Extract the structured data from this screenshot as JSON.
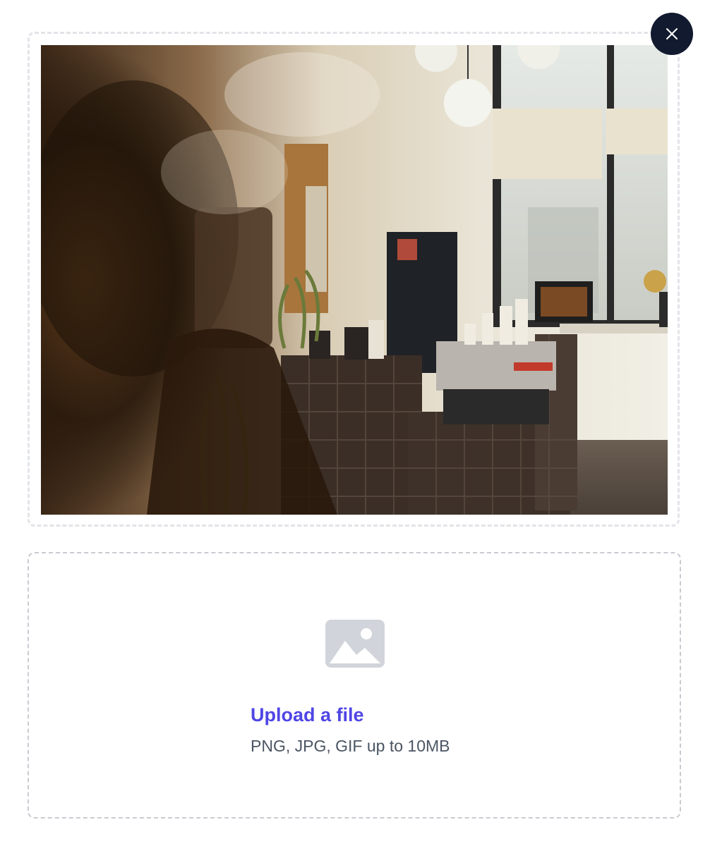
{
  "preview": {
    "image_alt": "Café interior with espresso machine, pendant lamps and window",
    "close_icon": "close-icon"
  },
  "upload": {
    "icon": "image-placeholder-icon",
    "link_label": "Upload a file",
    "hint": "PNG, JPG, GIF up to 10MB",
    "accent_color": "#4f46e5",
    "icon_color": "#d1d5db"
  }
}
